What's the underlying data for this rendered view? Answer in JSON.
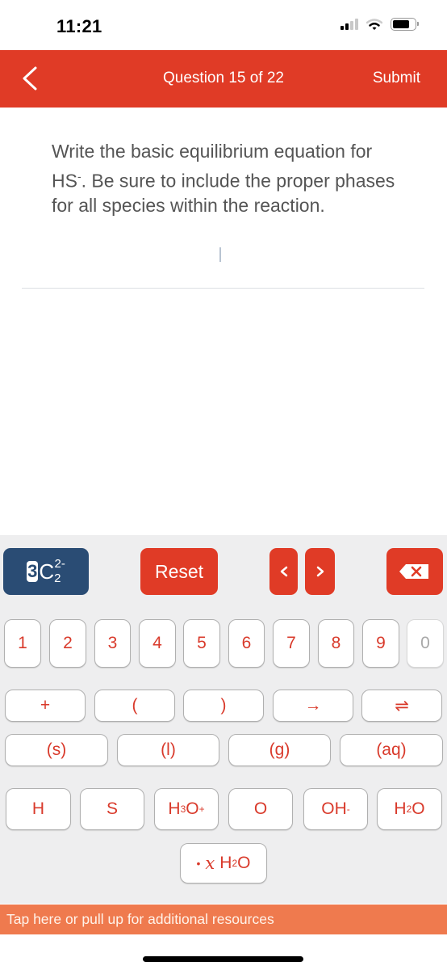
{
  "status_bar": {
    "time": "11:21",
    "icons": [
      "cellular-signal-icon",
      "wifi-icon",
      "battery-icon"
    ]
  },
  "header": {
    "back_icon": "chevron-left-icon",
    "title": "Question 15 of 22",
    "submit_label": "Submit"
  },
  "question": {
    "line_prefix": "Write the basic equilibrium equation for HS",
    "superscript": "-",
    "line_suffix": ". Be sure to include the proper phases for all species within the reaction."
  },
  "colors": {
    "brand_red": "#e03b26",
    "dark_blue": "#2a4c74",
    "keypad_bg": "#eeeeef",
    "key_text": "#d93a2b",
    "resources_bar": "#ef7a4e"
  },
  "keypad": {
    "charge_button": {
      "coefficient": "3",
      "element": "C",
      "subscript": "2",
      "superscript": "2-"
    },
    "reset_label": "Reset",
    "prev_icon": "chevron-left-icon",
    "next_icon": "chevron-right-icon",
    "backspace_icon": "backspace-icon",
    "digits": [
      "1",
      "2",
      "3",
      "4",
      "5",
      "6",
      "7",
      "8",
      "9",
      "0"
    ],
    "digit_disabled": [
      "0"
    ],
    "operators": [
      "+",
      "(",
      ")",
      "→",
      "⇌"
    ],
    "phases": [
      "(s)",
      "(l)",
      "(g)",
      "(aq)"
    ],
    "species": {
      "h": "H",
      "s": "S",
      "hydronium": {
        "base": "H",
        "sub": "3",
        "mid": "O",
        "sup": "+"
      },
      "o": "O",
      "hydroxide": {
        "base": "OH",
        "sup": "-"
      },
      "water": {
        "base": "H",
        "sub": "2",
        "mid": "O"
      }
    },
    "hydrate": {
      "dot": "•",
      "x": "x",
      "base": "H",
      "sub": "2",
      "mid": "O"
    }
  },
  "resources_bar": {
    "label": "Tap here or pull up for additional resources"
  }
}
